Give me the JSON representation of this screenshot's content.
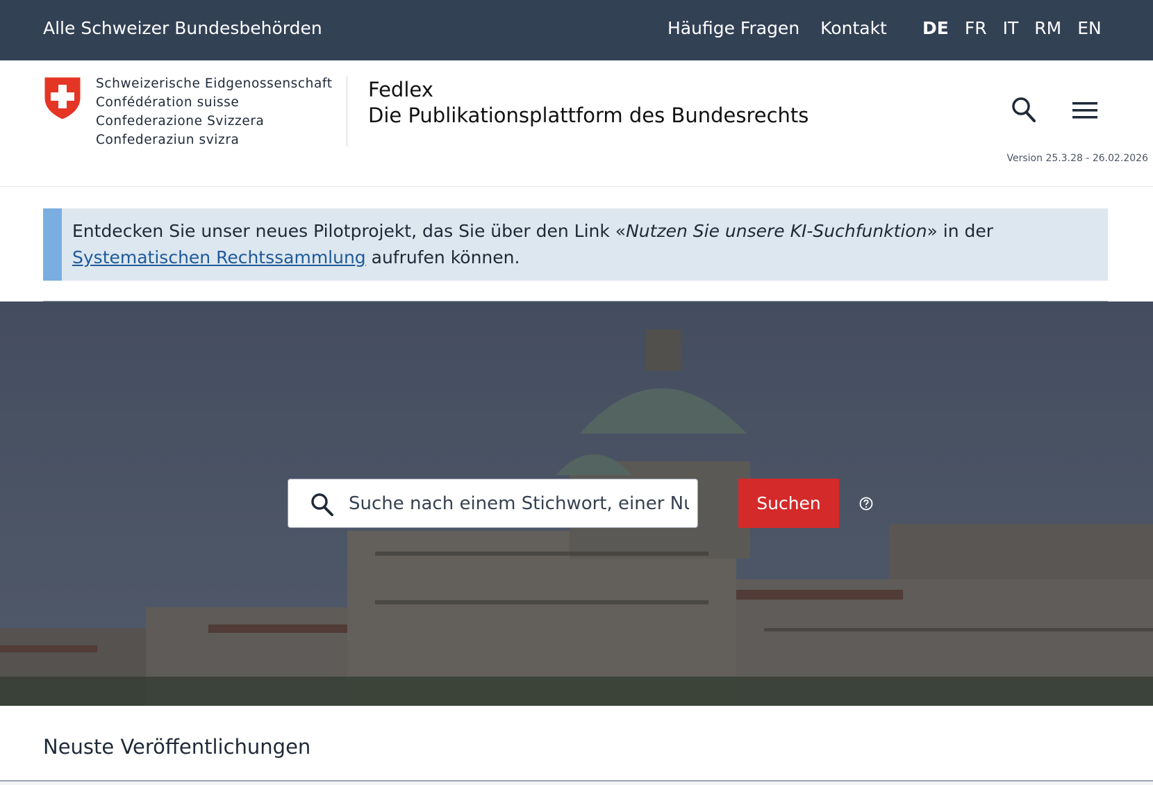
{
  "topbar": {
    "all_authorities": "Alle Schweizer Bundesbehörden",
    "faq": "Häufige Fragen",
    "contact": "Kontakt",
    "languages": [
      "DE",
      "FR",
      "IT",
      "RM",
      "EN"
    ],
    "active_language": "DE"
  },
  "header": {
    "confederation": [
      "Schweizerische Eidgenossenschaft",
      "Confédération suisse",
      "Confederazione Svizzera",
      "Confederaziun svizra"
    ],
    "title": "Fedlex",
    "subtitle": "Die Publikationsplattform des Bundesrechts",
    "version": "Version 25.3.28 - 26.02.2026",
    "icons": [
      "search-icon",
      "menu-icon"
    ]
  },
  "banner": {
    "text_before": "Entdecken Sie unser neues Pilotprojekt, das Sie über den Link «",
    "italic": "Nutzen Sie unsere KI-Suchfunktion",
    "text_middle": "» in der ",
    "link": "Systematischen Rechtssammlung",
    "text_after": " aufrufen können."
  },
  "search": {
    "placeholder": "Suche nach einem Stichwort, einer Nummer oder einem Titel",
    "button": "Suchen"
  },
  "section": {
    "title": "Neuste Veröffentlichungen"
  },
  "colors": {
    "topbar": "#334155",
    "accent_red": "#d42a2a",
    "banner_bg": "#dde7ef",
    "banner_border": "#7aaee0",
    "link": "#1e5a9a"
  }
}
